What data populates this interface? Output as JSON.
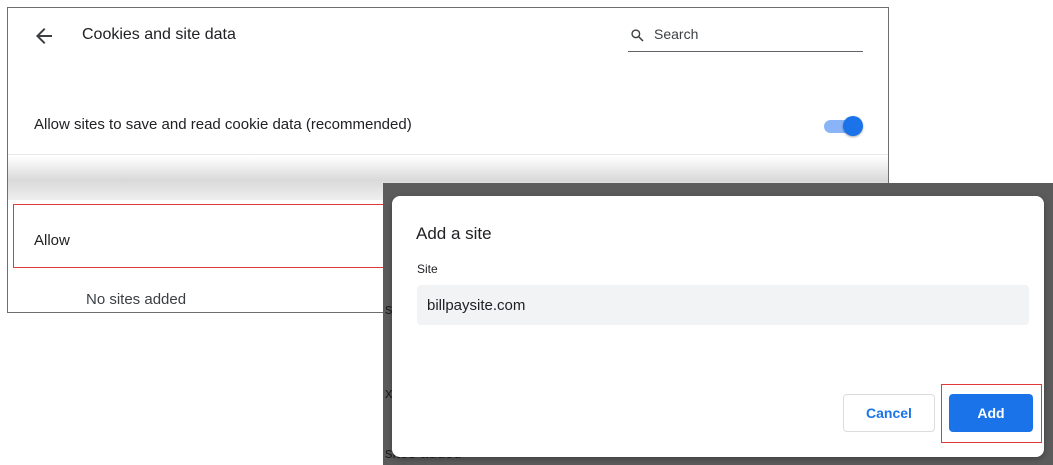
{
  "header": {
    "title": "Cookies and site data",
    "search_placeholder": "Search"
  },
  "settings": {
    "cookie_toggle_label": "Allow sites to save and read cookie data (recommended)",
    "cookie_toggle_on": true,
    "allow_section_label": "Allow",
    "no_sites_text": "No sites added"
  },
  "overlay": {
    "ghost_text_1": "s",
    "ghost_text_2": "x",
    "ghost_text_3": "sites added"
  },
  "dialog": {
    "title": "Add a site",
    "field_label": "Site",
    "site_value": "billpaysite.com",
    "cancel_label": "Cancel",
    "add_label": "Add"
  },
  "colors": {
    "accent": "#1a73e8",
    "toggle_track": "#8ab4f8",
    "highlight_border": "#e2383a"
  }
}
